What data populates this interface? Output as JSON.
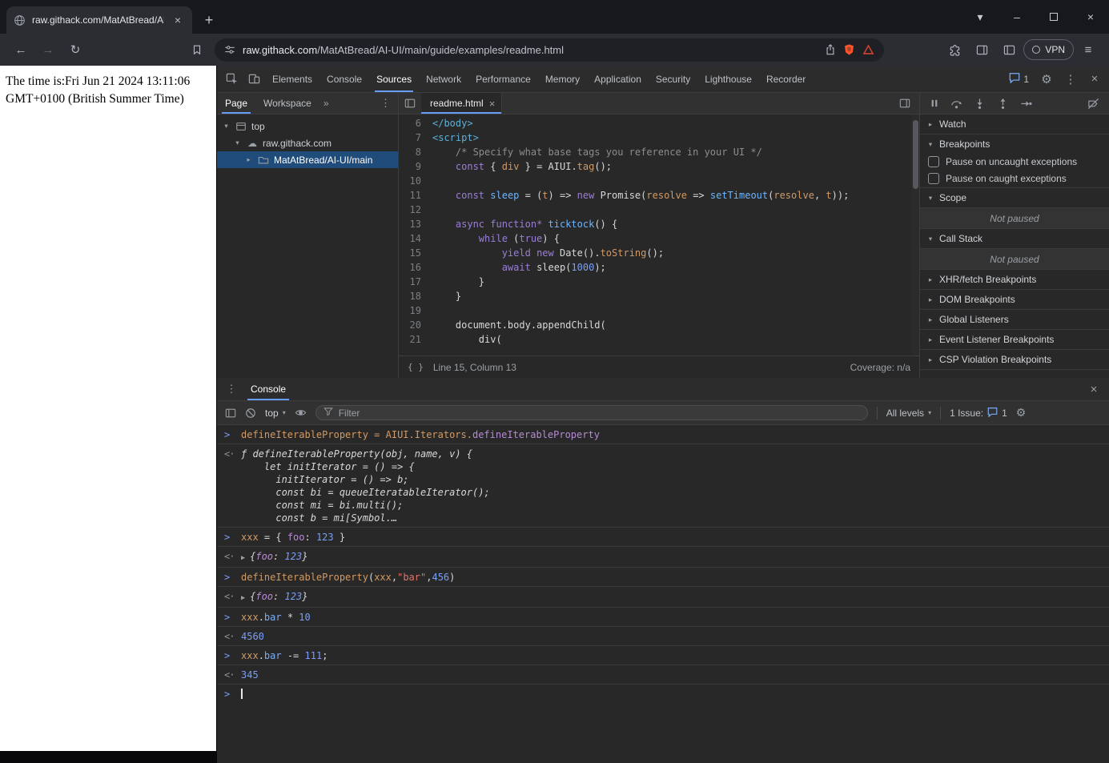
{
  "colors": {
    "accent": "#669cf4",
    "selection": "#1f4c7a",
    "shield": "#fb542b",
    "rewards": "#e0462e"
  },
  "glyphs": {
    "new_tab": "+",
    "tab_search": "▾",
    "minimize": "–",
    "close": "×",
    "back": "←",
    "forward": "→",
    "reload": "↻",
    "menu": "≡",
    "more_vert": "⋮",
    "gear": "⚙",
    "chevron_more": "»",
    "braces": "{ }",
    "expand_triangle": "▶",
    "caret_down": "▾",
    "caret_right": "▸",
    "cloud": "☁",
    "input_marker": ">",
    "output_marker": "<·"
  },
  "browser": {
    "tab_title": "raw.githack.com/MatAtBread/Al",
    "url_domain": "raw.githack.com",
    "url_path": "/MatAtBread/AI-UI/main/guide/examples/readme.html",
    "vpn_label": "VPN"
  },
  "page": {
    "time_text": "The time is:Fri Jun 21 2024 13:11:06 GMT+0100 (British Summer Time)"
  },
  "devtools": {
    "tabs": [
      "Elements",
      "Console",
      "Sources",
      "Network",
      "Performance",
      "Memory",
      "Application",
      "Security",
      "Lighthouse",
      "Recorder"
    ],
    "active_tab": "Sources",
    "issues_count": "1",
    "navigator": {
      "tabs": [
        "Page",
        "Workspace"
      ],
      "active_tab": "Page",
      "tree": [
        {
          "label": "top",
          "icon": "frame",
          "depth": 0,
          "chevron": "down",
          "selected": false
        },
        {
          "label": "raw.githack.com",
          "icon": "cloud",
          "depth": 1,
          "chevron": "down",
          "selected": false
        },
        {
          "label": "MatAtBread/AI-UI/main",
          "icon": "folder",
          "depth": 2,
          "chevron": "right",
          "selected": true
        }
      ]
    },
    "editor": {
      "file_tab": "readme.html",
      "status_position": "Line 15, Column 13",
      "status_coverage": "Coverage: n/a",
      "lines": [
        {
          "n": 6,
          "segs": [
            [
              "</body>",
              "tag"
            ]
          ]
        },
        {
          "n": 7,
          "segs": [
            [
              "<script>",
              "tag"
            ]
          ]
        },
        {
          "n": 8,
          "segs": [
            [
              "    ",
              ""
            ],
            [
              "/* Specify what base tags you reference in your UI */",
              "com"
            ]
          ]
        },
        {
          "n": 9,
          "segs": [
            [
              "    ",
              ""
            ],
            [
              "const",
              "k"
            ],
            [
              " { ",
              ""
            ],
            [
              "div",
              "vo"
            ],
            [
              " } = ",
              ""
            ],
            [
              "AIUI",
              ""
            ],
            [
              ".",
              ""
            ],
            [
              "tag",
              "prop"
            ],
            [
              "();",
              ""
            ]
          ]
        },
        {
          "n": 10,
          "segs": []
        },
        {
          "n": 11,
          "segs": [
            [
              "    ",
              ""
            ],
            [
              "const",
              "k"
            ],
            [
              " ",
              ""
            ],
            [
              "sleep",
              "fn"
            ],
            [
              " = (",
              ""
            ],
            [
              "t",
              "vo"
            ],
            [
              ") => ",
              ""
            ],
            [
              "new",
              "k"
            ],
            [
              " ",
              ""
            ],
            [
              "Promise",
              ""
            ],
            [
              "(",
              ""
            ],
            [
              "resolve",
              "vo"
            ],
            [
              " => ",
              ""
            ],
            [
              "setTimeout",
              "fn"
            ],
            [
              "(",
              ""
            ],
            [
              "resolve",
              "vo"
            ],
            [
              ", ",
              ""
            ],
            [
              "t",
              "vo"
            ],
            [
              "));",
              ""
            ]
          ]
        },
        {
          "n": 12,
          "segs": []
        },
        {
          "n": 13,
          "segs": [
            [
              "    ",
              ""
            ],
            [
              "async",
              "k"
            ],
            [
              " ",
              ""
            ],
            [
              "function*",
              "k"
            ],
            [
              " ",
              ""
            ],
            [
              "ticktock",
              "fn"
            ],
            [
              "() {",
              ""
            ]
          ]
        },
        {
          "n": 14,
          "segs": [
            [
              "        ",
              ""
            ],
            [
              "while",
              "k"
            ],
            [
              " (",
              ""
            ],
            [
              "true",
              "k"
            ],
            [
              ") {",
              ""
            ]
          ]
        },
        {
          "n": 15,
          "segs": [
            [
              "            ",
              ""
            ],
            [
              "yield",
              "k"
            ],
            [
              " ",
              ""
            ],
            [
              "new",
              "k"
            ],
            [
              " ",
              ""
            ],
            [
              "Date",
              ""
            ],
            [
              "().",
              ""
            ],
            [
              "toString",
              "prop"
            ],
            [
              "();",
              ""
            ]
          ]
        },
        {
          "n": 16,
          "segs": [
            [
              "            ",
              ""
            ],
            [
              "await",
              "k"
            ],
            [
              " ",
              ""
            ],
            [
              "sleep",
              ""
            ],
            [
              "(",
              ""
            ],
            [
              "1000",
              "num"
            ],
            [
              ");",
              ""
            ]
          ]
        },
        {
          "n": 17,
          "segs": [
            [
              "        }",
              ""
            ]
          ]
        },
        {
          "n": 18,
          "segs": [
            [
              "    }",
              ""
            ]
          ]
        },
        {
          "n": 19,
          "segs": []
        },
        {
          "n": 20,
          "segs": [
            [
              "    ",
              ""
            ],
            [
              "document.body.appendChild(",
              ""
            ]
          ]
        },
        {
          "n": 21,
          "segs": [
            [
              "        div(",
              ""
            ]
          ]
        }
      ]
    },
    "debugger": {
      "sections": [
        {
          "label": "Watch",
          "expanded": false
        },
        {
          "label": "Breakpoints",
          "expanded": true,
          "checkboxes": [
            {
              "label": "Pause on uncaught exceptions",
              "checked": false
            },
            {
              "label": "Pause on caught exceptions",
              "checked": false
            }
          ]
        },
        {
          "label": "Scope",
          "expanded": true,
          "note": "Not paused"
        },
        {
          "label": "Call Stack",
          "expanded": true,
          "note": "Not paused"
        },
        {
          "label": "XHR/fetch Breakpoints",
          "expanded": false
        },
        {
          "label": "DOM Breakpoints",
          "expanded": false
        },
        {
          "label": "Global Listeners",
          "expanded": false
        },
        {
          "label": "Event Listener Breakpoints",
          "expanded": false
        },
        {
          "label": "CSP Violation Breakpoints",
          "expanded": false
        }
      ]
    },
    "console": {
      "tab_label": "Console",
      "context_label": "top",
      "filter_placeholder": "Filter",
      "levels_label": "All levels",
      "issues_label": "1 Issue:",
      "issues_count": "1",
      "entries": [
        {
          "kind": "input",
          "segs": [
            [
              "defineIterableProperty = AIUI.Iterators.",
              "vo"
            ],
            [
              "defineIterableProperty",
              "key"
            ]
          ]
        },
        {
          "kind": "result-fn",
          "lines": [
            [
              [
                "ƒ ",
                "fnit"
              ],
              [
                "defineIterableProperty(obj, name, v) {",
                ""
              ]
            ],
            [
              [
                "    let initIterator = () => {",
                ""
              ]
            ],
            [
              [
                "      initIterator = () => b;",
                ""
              ]
            ],
            [
              [
                "      const bi = queueIteratableIterator();",
                ""
              ]
            ],
            [
              [
                "      const mi = bi.multi();",
                ""
              ]
            ],
            [
              [
                "      const b = mi[Symbol.…",
                ""
              ]
            ]
          ]
        },
        {
          "kind": "input",
          "segs": [
            [
              "xxx",
              "vo"
            ],
            [
              " = { ",
              ""
            ],
            [
              "foo",
              "key"
            ],
            [
              ": ",
              ""
            ],
            [
              "123",
              "num"
            ],
            [
              " }",
              ""
            ]
          ]
        },
        {
          "kind": "result",
          "expand": true,
          "segs": [
            [
              "{",
              ""
            ],
            [
              "foo",
              "key"
            ],
            [
              ": ",
              ""
            ],
            [
              "123",
              "num"
            ],
            [
              "}",
              ""
            ]
          ]
        },
        {
          "kind": "input",
          "segs": [
            [
              "defineIterableProperty",
              "vo"
            ],
            [
              "(",
              ""
            ],
            [
              "xxx",
              "vo"
            ],
            [
              ",",
              ""
            ],
            [
              "\"bar\"",
              "str"
            ],
            [
              ",",
              ""
            ],
            [
              "456",
              "num"
            ],
            [
              ")",
              ""
            ]
          ]
        },
        {
          "kind": "result",
          "expand": true,
          "segs": [
            [
              "{",
              ""
            ],
            [
              "foo",
              "key"
            ],
            [
              ": ",
              ""
            ],
            [
              "123",
              "num"
            ],
            [
              "}",
              ""
            ]
          ]
        },
        {
          "kind": "input",
          "segs": [
            [
              "xxx",
              "vo"
            ],
            [
              ".",
              ""
            ],
            [
              "bar",
              "propb"
            ],
            [
              " * ",
              ""
            ],
            [
              "10",
              "num"
            ]
          ]
        },
        {
          "kind": "result",
          "expand": false,
          "segs": [
            [
              "4560",
              "num"
            ]
          ]
        },
        {
          "kind": "input",
          "segs": [
            [
              "xxx",
              "vo"
            ],
            [
              ".",
              ""
            ],
            [
              "bar",
              "propb"
            ],
            [
              " -= ",
              ""
            ],
            [
              "111",
              "num"
            ],
            [
              ";",
              ""
            ]
          ]
        },
        {
          "kind": "result",
          "expand": false,
          "segs": [
            [
              "345",
              "num"
            ]
          ]
        },
        {
          "kind": "prompt"
        }
      ]
    }
  }
}
